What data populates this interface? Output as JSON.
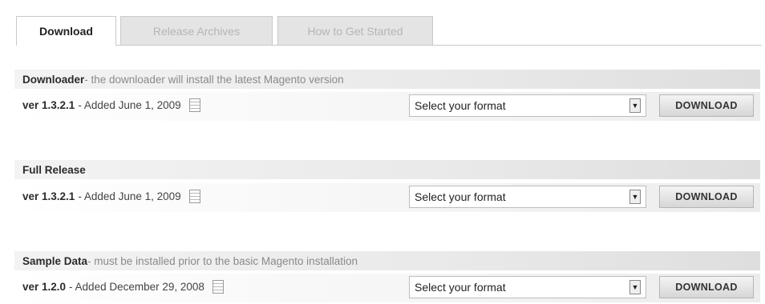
{
  "tabs": [
    {
      "label": "Download",
      "active": true
    },
    {
      "label": "Release Archives",
      "active": false
    },
    {
      "label": "How to Get Started",
      "active": false
    }
  ],
  "sections": [
    {
      "title": "Downloader",
      "description": " - the downloader will install the latest Magento version",
      "version": "ver 1.3.2.1",
      "added": "- Added June 1, 2009",
      "select_value": "Select your format",
      "button_label": "DOWNLOAD"
    },
    {
      "title": "Full Release",
      "description": "",
      "version": "ver 1.3.2.1",
      "added": "- Added June 1, 2009",
      "select_value": "Select your format",
      "button_label": "DOWNLOAD"
    },
    {
      "title": "Sample Data",
      "description": " - must be installed prior to the basic Magento installation",
      "version": "ver 1.2.0",
      "added": "- Added December 29, 2008",
      "select_value": "Select your format",
      "button_label": "DOWNLOAD"
    }
  ],
  "icons": {
    "document": "document-icon",
    "dropdown": "dropdown-arrow-icon"
  }
}
